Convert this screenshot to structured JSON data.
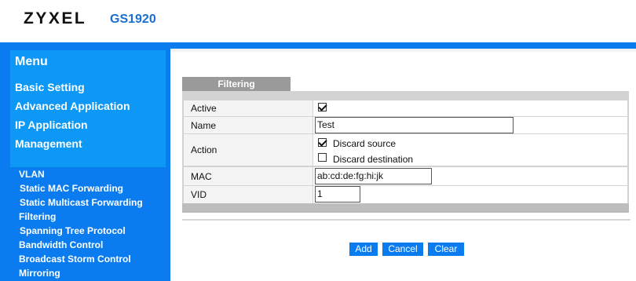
{
  "header": {
    "logo": "ZYXEL",
    "model": "GS1920"
  },
  "sidebar": {
    "title": "Menu",
    "categories": [
      "Basic Setting",
      "Advanced Application",
      "IP Application",
      "Management"
    ],
    "items": [
      "VLAN",
      "Static MAC Forwarding",
      "Static Multicast Forwarding",
      "Filtering",
      "Spanning Tree Protocol",
      "Bandwidth Control",
      "Broadcast Storm Control",
      "Mirroring"
    ]
  },
  "form": {
    "tab": "Filtering",
    "active_label": "Active",
    "active_checked": true,
    "name_label": "Name",
    "name_value": "Test",
    "action_label": "Action",
    "discard_source_label": "Discard source",
    "discard_source_checked": true,
    "discard_destination_label": "Discard destination",
    "discard_destination_checked": false,
    "mac_label": "MAC",
    "mac_value": "ab:cd:de:fg:hi:jk",
    "vid_label": "VID",
    "vid_value": "1"
  },
  "buttons": {
    "add": "Add",
    "cancel": "Cancel",
    "clear": "Clear"
  },
  "colors": {
    "accent": "#0a7cf0",
    "menu_box": "#0d98f5",
    "brand_model": "#1a6fd1"
  }
}
